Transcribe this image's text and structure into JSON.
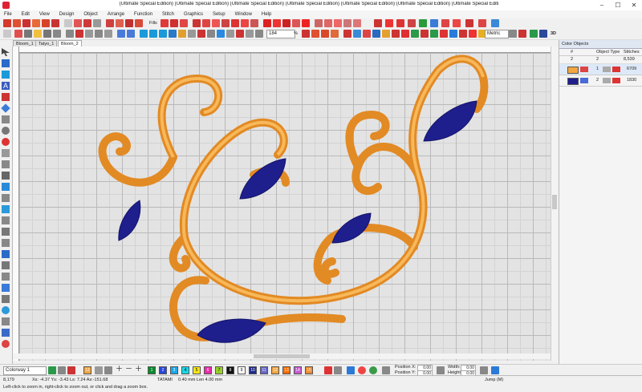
{
  "window": {
    "title": "(Ultimate Special Edition) (Ultimate Special Edition) (Ultimate Special Edition) (Ultimate Special Edition) (Ultimate Special Edition) (Ultimate Special Edition) (Ultimate Special Editi"
  },
  "menu": {
    "items": [
      "File",
      "Edit",
      "View",
      "Design",
      "Object",
      "Arrange",
      "Function",
      "Stitch",
      "Graphics",
      "Setup",
      "Window",
      "Help"
    ]
  },
  "toolbar": {
    "zoom_value": "184",
    "zoom_unit": "%",
    "fills_label": "Fills",
    "units_select": "Metric",
    "view_3d_label": "3D"
  },
  "tabs": [
    "Bloom_1",
    "Tatyo_1",
    "Bloom_2"
  ],
  "panel": {
    "title": "Color Objects",
    "headers": {
      "num": "#",
      "object_type": "Object Type",
      "stitches": "Stitches"
    },
    "summary": {
      "count_a": "2",
      "count_b": "2",
      "stitches": "8,539"
    },
    "objects": [
      {
        "index": "1",
        "stitches": "6709",
        "color": "#f2a640"
      },
      {
        "index": "2",
        "stitches": "1830",
        "color": "#1e1e8c"
      }
    ]
  },
  "colorway": {
    "label": "Colorway 1",
    "swatches": [
      {
        "label": "1",
        "color": "#0a8a2e"
      },
      {
        "label": "2",
        "color": "#2a46d8"
      },
      {
        "label": "3",
        "color": "#1aa6e8"
      },
      {
        "label": "4",
        "color": "#18d6e6"
      },
      {
        "label": "5",
        "color": "#f5e61e"
      },
      {
        "label": "6",
        "color": "#ec2aa8"
      },
      {
        "label": "7",
        "color": "#9ad02a"
      },
      {
        "label": "8",
        "color": "#111111"
      },
      {
        "label": "9",
        "color": "#ffffff"
      },
      {
        "label": "10",
        "color": "#1d2a8a"
      },
      {
        "label": "11",
        "color": "#6464c8"
      },
      {
        "label": "12",
        "color": "#f2a640"
      },
      {
        "label": "13",
        "color": "#ff6a00"
      },
      {
        "label": "14",
        "color": "#c85ad2"
      },
      {
        "label": "15",
        "color": "#ef8a30"
      }
    ],
    "current_color": "#f2a640",
    "current_label": "12"
  },
  "properties": {
    "position_x_label": "Position X:",
    "position_x": "0.00",
    "position_y_label": "Position Y:",
    "position_y": "0.00",
    "width_label": "Width:",
    "width": "0.00",
    "height_label": "Height:",
    "height": "0.00"
  },
  "status": {
    "stitches": "8,179",
    "coords": "Xs: -4.37  Ys: -3.43  Ls:  7.24  As:-151.68",
    "tatami": "TATAMI",
    "lengths": "0.40 mm  Len  4.00 mm",
    "jump": "Jump (M)",
    "hint": "Left-click to zoom in, right-click to zoom out, or click and drag a zoom box."
  }
}
